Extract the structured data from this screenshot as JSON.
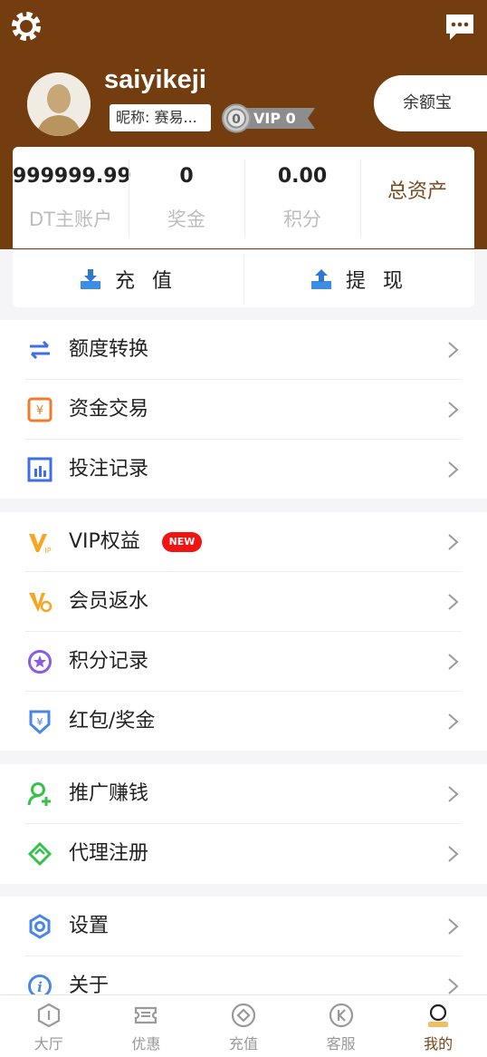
{
  "header": {
    "username": "saiyikeji",
    "nickname": "昵称: 赛易...",
    "vip_label": "VIP 0",
    "vip_level": "0",
    "yuebao_label": "余额宝"
  },
  "stats": [
    {
      "value": "999999.99",
      "label": "DT主账户"
    },
    {
      "value": "0",
      "label": "奖金"
    },
    {
      "value": "0.00",
      "label": "积分"
    }
  ],
  "total_assets_label": "总资产",
  "actions": {
    "recharge": "充 值",
    "withdraw": "提 现"
  },
  "menu": {
    "group1": [
      "额度转换",
      "资金交易",
      "投注记录"
    ],
    "group2": [
      "VIP权益",
      "会员返水",
      "积分记录",
      "红包/奖金"
    ],
    "group3": [
      "推广赚钱",
      "代理注册"
    ],
    "group4": [
      "设置",
      "关于"
    ],
    "new_badge": "NEW"
  },
  "tabbar": [
    {
      "label": "大厅",
      "icon": "hall-icon"
    },
    {
      "label": "优惠",
      "icon": "ticket-icon"
    },
    {
      "label": "充值",
      "icon": "recharge-icon"
    },
    {
      "label": "客服",
      "icon": "service-icon"
    },
    {
      "label": "我的",
      "icon": "profile-icon",
      "active": true
    }
  ],
  "colors": {
    "header_bg": "#743d10",
    "accent_brown": "#7a4518",
    "new_badge": "#f21313",
    "icon_blue": "#3f6fe0"
  }
}
